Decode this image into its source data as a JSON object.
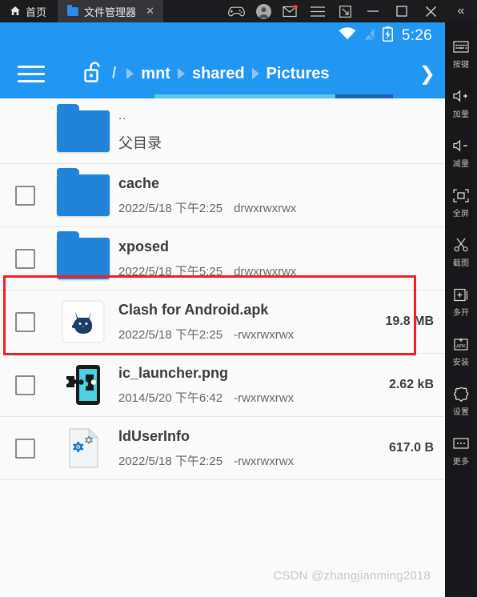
{
  "titlebar": {
    "home_label": "首页",
    "home_icon": "home-icon",
    "tab": {
      "label": "文件管理器",
      "icon": "folder-icon",
      "close_label": "✕"
    },
    "icons": [
      {
        "name": "gamepad-icon",
        "label": "gamepad"
      },
      {
        "name": "account-avatar-icon",
        "label": "account"
      },
      {
        "name": "mail-icon",
        "label": "mail",
        "badge": true
      },
      {
        "name": "menu-icon",
        "label": "menu"
      },
      {
        "name": "resize-icon",
        "label": "resize"
      }
    ],
    "window_controls": [
      {
        "name": "minimize-button",
        "glyph": "—"
      },
      {
        "name": "maximize-button",
        "glyph": "▢"
      },
      {
        "name": "close-button",
        "glyph": "✕"
      }
    ],
    "collapse_glyph": "«"
  },
  "statusbar": {
    "wifi_icon": "wifi-icon",
    "signal_icon": "signal-off-icon",
    "battery_icon": "battery-charging-icon",
    "time": "5:26"
  },
  "appbar": {
    "menu_icon": "hamburger-menu-icon",
    "lock_icon": "unlock-icon",
    "root": "/",
    "crumbs": [
      "mnt",
      "shared",
      "Pictures"
    ],
    "next_glyph": "❯",
    "accent": "#2196f3"
  },
  "files": [
    {
      "name": "..",
      "subtitle": "父目录",
      "icon": "folder-icon",
      "type": "parent",
      "checkbox": false,
      "date": "",
      "perm": "",
      "size": ""
    },
    {
      "name": "cache",
      "icon": "folder-icon",
      "type": "folder",
      "checkbox": true,
      "date": "2022/5/18 下午2:25",
      "perm": "drwxrwxrwx",
      "size": ""
    },
    {
      "name": "xposed",
      "icon": "folder-icon",
      "type": "folder",
      "checkbox": true,
      "date": "2022/5/18 下午5:25",
      "perm": "drwxrwxrwx",
      "size": "",
      "highlighted": true
    },
    {
      "name": "Clash for Android.apk",
      "icon": "clash-cat-icon",
      "type": "apk",
      "checkbox": true,
      "date": "2022/5/18 下午2:25",
      "perm": "-rwxrwxrwx",
      "size": "19.8 MB"
    },
    {
      "name": "ic_launcher.png",
      "icon": "xposed-puzzle-icon",
      "type": "image",
      "checkbox": true,
      "date": "2014/5/20 下午6:42",
      "perm": "-rwxrwxrwx",
      "size": "2.62 kB"
    },
    {
      "name": "ldUserInfo",
      "icon": "config-file-icon",
      "type": "file",
      "checkbox": true,
      "date": "2022/5/18 下午2:25",
      "perm": "-rwxrwxrwx",
      "size": "617.0 B"
    }
  ],
  "annotation": {
    "color": "#f41e1e",
    "target": "xposed"
  },
  "watermark": "CSDN @zhangjianming2018",
  "sidebar": {
    "items": [
      {
        "label": "按键",
        "icon": "keyboard-icon"
      },
      {
        "label": "加量",
        "icon": "volume-up-icon"
      },
      {
        "label": "减量",
        "icon": "volume-down-icon"
      },
      {
        "label": "全屏",
        "icon": "fullscreen-icon"
      },
      {
        "label": "截图",
        "icon": "scissors-screenshot-icon"
      },
      {
        "label": "多开",
        "icon": "multi-instance-icon"
      },
      {
        "label": "安装",
        "icon": "apk-install-icon"
      },
      {
        "label": "设置",
        "icon": "settings-gear-icon"
      },
      {
        "label": "更多",
        "icon": "more-dots-icon"
      }
    ]
  }
}
